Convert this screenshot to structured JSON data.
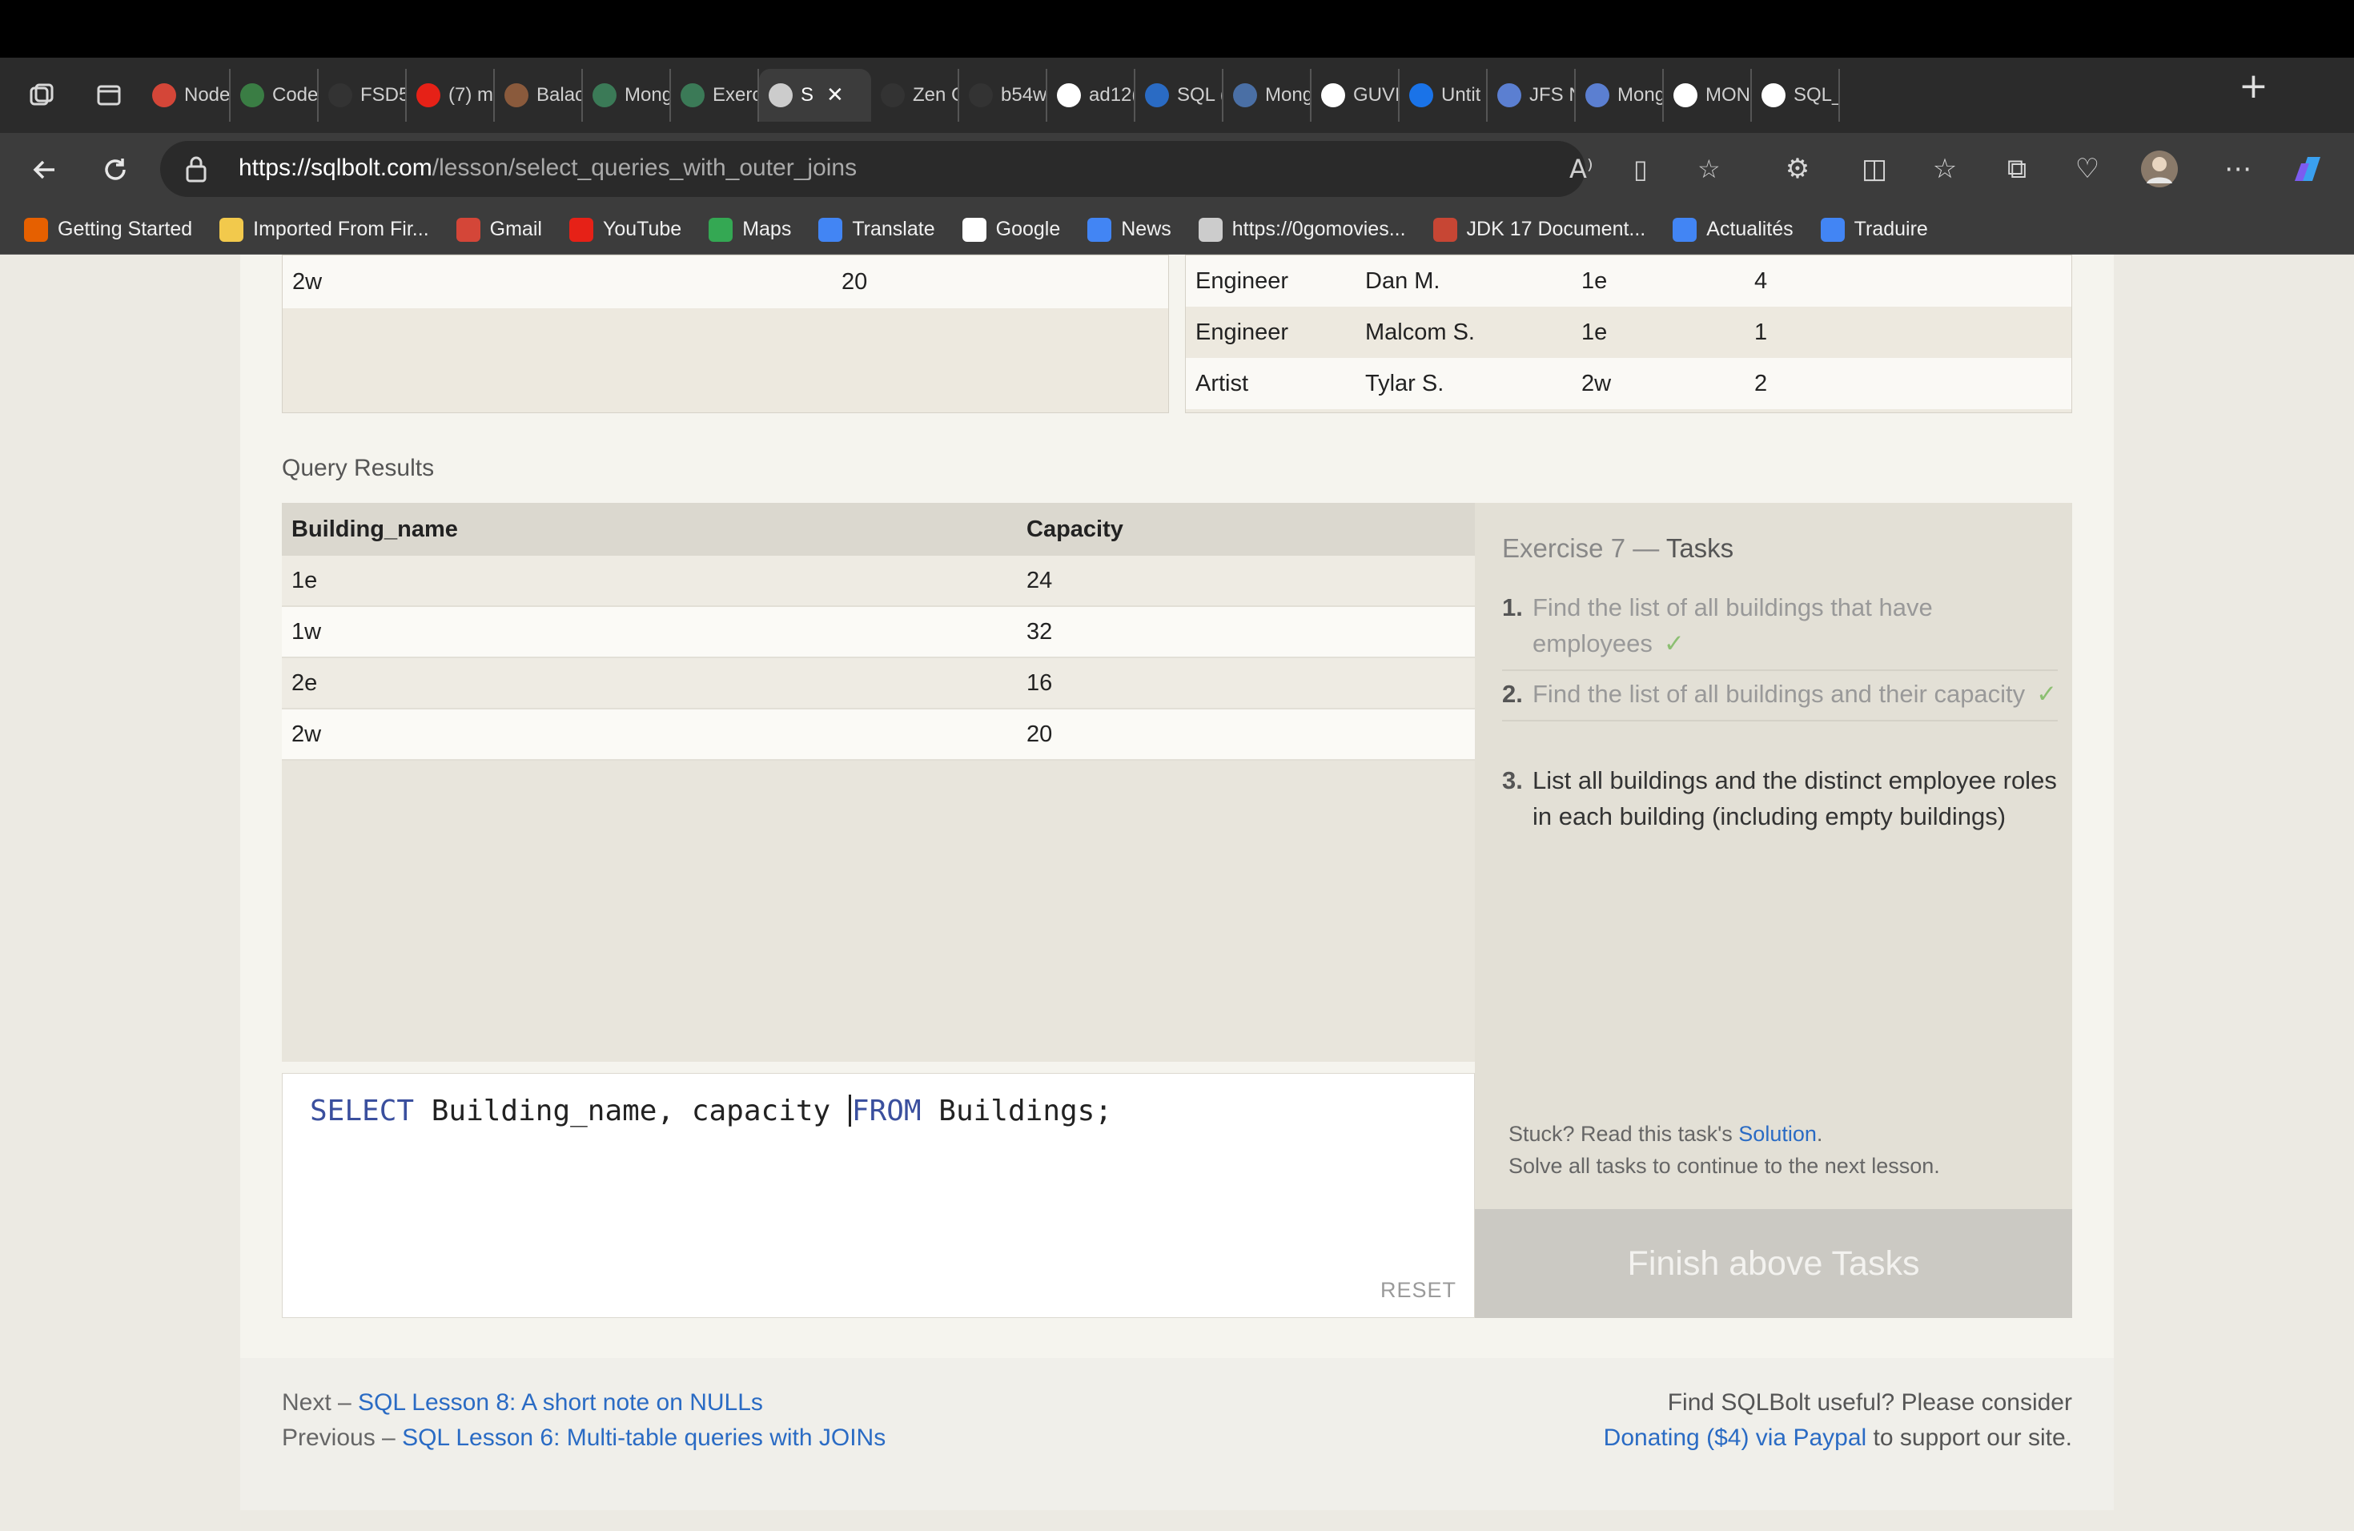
{
  "browser": {
    "tabs": [
      {
        "label": "Node",
        "icon": "gmail-icon",
        "color": "#d44638"
      },
      {
        "label": "Code",
        "icon": "code-icon",
        "color": "#3a7d44"
      },
      {
        "label": "FSD5",
        "icon": "github-icon",
        "color": "#333333"
      },
      {
        "label": "(7) m",
        "icon": "youtube-icon",
        "color": "#e62117"
      },
      {
        "label": "Balac",
        "icon": "avatar-icon",
        "color": "#8a5a3c"
      },
      {
        "label": "Mong",
        "icon": "w3schools-icon",
        "color": "#3b7a57"
      },
      {
        "label": "Exerc",
        "icon": "w3schools-icon",
        "color": "#3b7a57"
      },
      {
        "label": "S",
        "icon": "database-icon",
        "color": "#cccccc"
      },
      {
        "label": "Zen C",
        "icon": "zen-icon",
        "color": "#333333"
      },
      {
        "label": "b54w",
        "icon": "github-icon",
        "color": "#333333"
      },
      {
        "label": "ad12(",
        "icon": "github-icon",
        "color": "#ffffff"
      },
      {
        "label": "SQL (",
        "icon": "sql-icon",
        "color": "#2a6bc4"
      },
      {
        "label": "Mong",
        "icon": "search-icon",
        "color": "#4a6fa5"
      },
      {
        "label": "GUVI",
        "icon": "github-icon",
        "color": "#ffffff"
      },
      {
        "label": "Untit",
        "icon": "share-icon",
        "color": "#1a73e8"
      },
      {
        "label": "JFS N",
        "icon": "doc-icon",
        "color": "#5b7fd1"
      },
      {
        "label": "Mong",
        "icon": "doc-icon",
        "color": "#5b7fd1"
      },
      {
        "label": "MON",
        "icon": "github-icon",
        "color": "#ffffff"
      },
      {
        "label": "SQL_",
        "icon": "github-icon",
        "color": "#ffffff"
      }
    ],
    "url_host": "https://sqlbolt.com",
    "url_path": "/lesson/select_queries_with_outer_joins",
    "bookmarks": [
      {
        "label": "Getting Started",
        "color": "#e66000"
      },
      {
        "label": "Imported From Fir...",
        "color": "#f2c94c"
      },
      {
        "label": "Gmail",
        "color": "#d44638"
      },
      {
        "label": "YouTube",
        "color": "#e62117"
      },
      {
        "label": "Maps",
        "color": "#34a853"
      },
      {
        "label": "Translate",
        "color": "#4285f4"
      },
      {
        "label": "Google",
        "color": "#ffffff"
      },
      {
        "label": "News",
        "color": "#4285f4"
      },
      {
        "label": "https://0gomovies...",
        "color": "#cccccc"
      },
      {
        "label": "JDK 17 Document...",
        "color": "#c74634"
      },
      {
        "label": "Actualités",
        "color": "#4285f4"
      },
      {
        "label": "Traduire",
        "color": "#4285f4"
      }
    ]
  },
  "top_tables": {
    "left_row": {
      "building": "2w",
      "capacity": "20"
    },
    "right_rows": [
      {
        "role": "Engineer",
        "name": "Dan M.",
        "building": "1e",
        "years": "4"
      },
      {
        "role": "Engineer",
        "name": "Malcom S.",
        "building": "1e",
        "years": "1"
      },
      {
        "role": "Artist",
        "name": "Tylar S.",
        "building": "2w",
        "years": "2"
      }
    ]
  },
  "results": {
    "label": "Query Results",
    "columns": [
      "Building_name",
      "Capacity"
    ],
    "rows": [
      [
        "1e",
        "24"
      ],
      [
        "1w",
        "32"
      ],
      [
        "2e",
        "16"
      ],
      [
        "2w",
        "20"
      ]
    ]
  },
  "editor": {
    "kw_select": "SELECT",
    "part1": " Building_name, capacity ",
    "kw_from": "FROM",
    "part2": " Buildings;",
    "reset_label": "RESET"
  },
  "tasks": {
    "title_prefix": "Exercise 7 — ",
    "title_main": "Tasks",
    "items": [
      {
        "num": "1.",
        "text": "Find the list of all buildings that have employees",
        "check": "✓"
      },
      {
        "num": "2.",
        "text": "Find the list of all buildings and their capacity",
        "check": "✓"
      },
      {
        "num": "3.",
        "text": "List all buildings and the distinct employee roles in each building (including empty buildings)",
        "check": ""
      }
    ],
    "stuck_prefix": "Stuck? Read this task's ",
    "solution_link": "Solution",
    "stuck_suffix": ".",
    "continue_note": "Solve all tasks to continue to the next lesson.",
    "finish_label": "Finish above Tasks"
  },
  "footer": {
    "next_prefix": "Next – ",
    "next_link": "SQL Lesson 8: A short note on NULLs",
    "prev_prefix": "Previous – ",
    "prev_link": "SQL Lesson 6: Multi-table queries with JOINs",
    "donate_line1": "Find SQLBolt useful? Please consider",
    "donate_link": "Donating ($4) via Paypal",
    "donate_suffix": " to support our site."
  }
}
